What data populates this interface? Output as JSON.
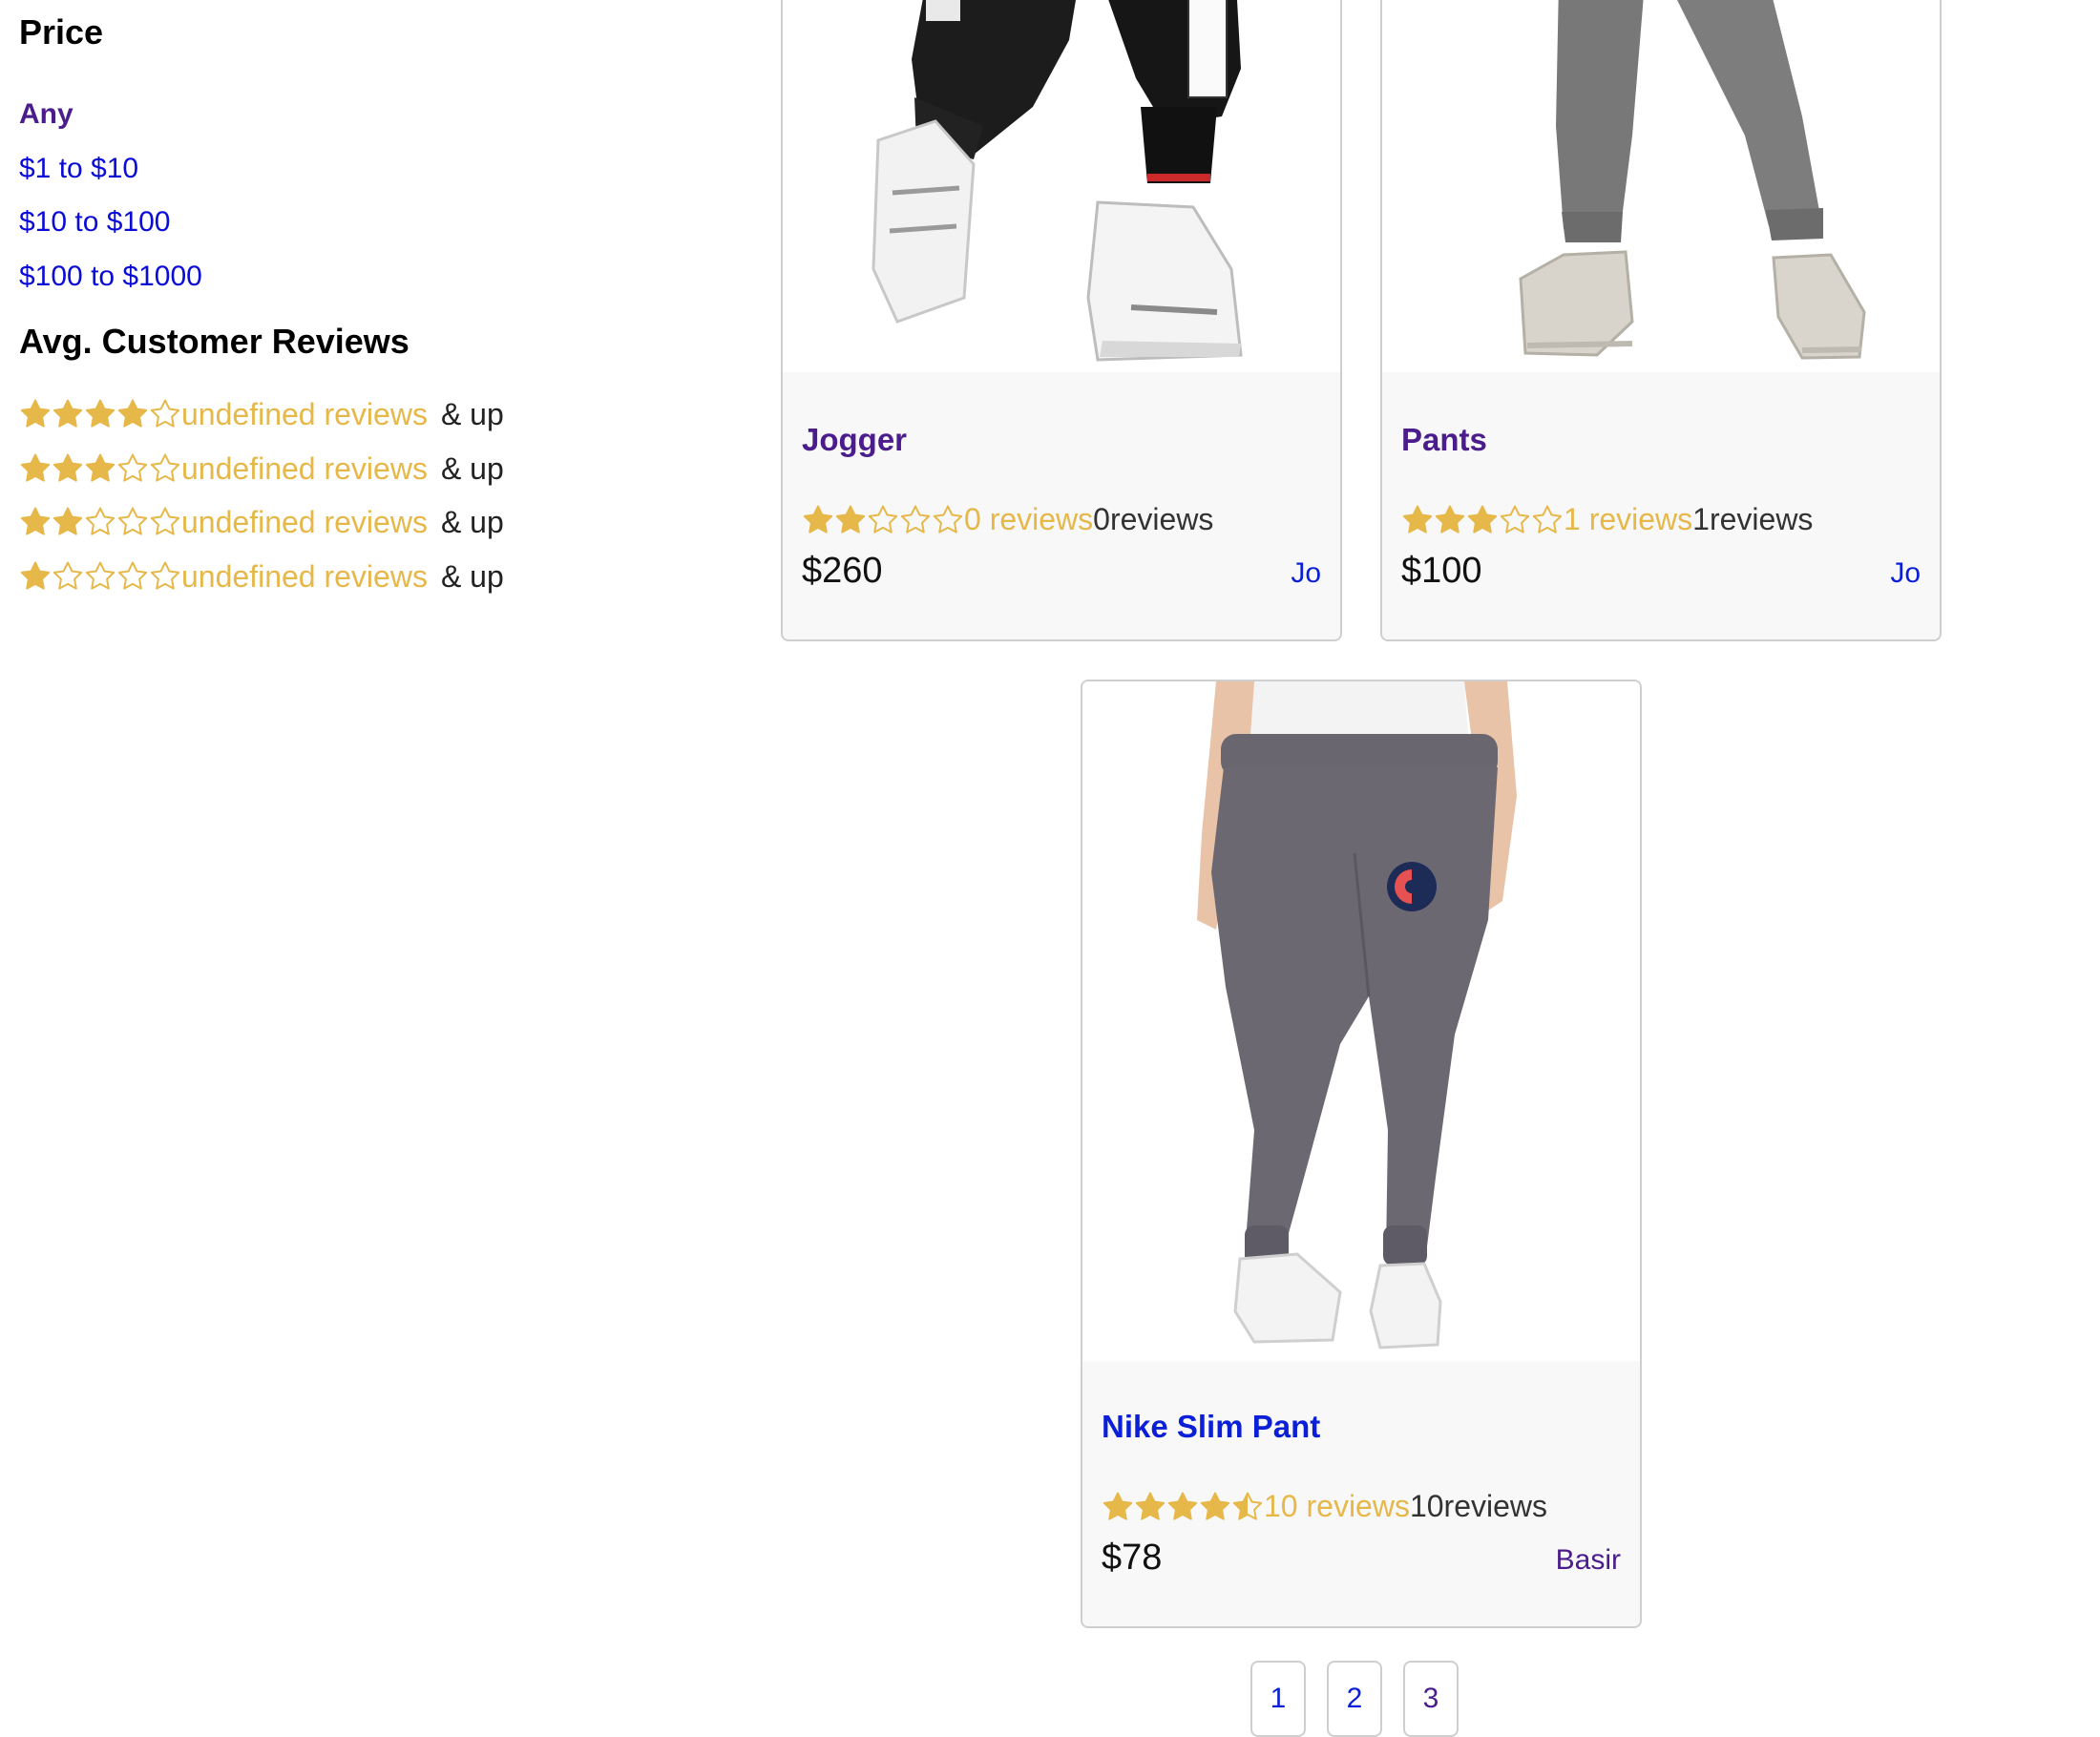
{
  "sidebar": {
    "price_heading": "Price",
    "price_options": [
      "Any",
      "$1 to $10",
      "$10 to $100",
      "$100 to $1000"
    ],
    "reviews_heading": "Avg. Customer Reviews",
    "review_filters": [
      {
        "stars": 4,
        "label": "undefined reviews",
        "suffix": "& up"
      },
      {
        "stars": 3,
        "label": "undefined reviews",
        "suffix": "& up"
      },
      {
        "stars": 2,
        "label": "undefined reviews",
        "suffix": "& up"
      },
      {
        "stars": 1,
        "label": "undefined reviews",
        "suffix": "& up"
      }
    ]
  },
  "products": [
    {
      "name": "Jogger",
      "rating": 2,
      "reviews_link": "0 reviews",
      "reviews_count": "0reviews",
      "price": "$260",
      "seller": "Jo",
      "image": "black-jogger-pants-image"
    },
    {
      "name": "Pants",
      "rating": 3,
      "reviews_link": "1 reviews",
      "reviews_count": "1reviews",
      "price": "$100",
      "seller": "Jo",
      "image": "gray-pants-image"
    },
    {
      "name": "Nike Slim Pant",
      "rating": 4.5,
      "reviews_link": "10 reviews",
      "reviews_count": "10reviews",
      "price": "$78",
      "seller": "Basir",
      "image": "gray-sweatpants-image"
    }
  ],
  "pagination": {
    "pages": [
      "1",
      "2",
      "3"
    ]
  },
  "colors": {
    "star": "#e6b84a",
    "link": "#0b1fd6",
    "visited": "#4b1d8c",
    "card_border": "#cfcfcf",
    "card_bg": "#f8f8f8"
  }
}
